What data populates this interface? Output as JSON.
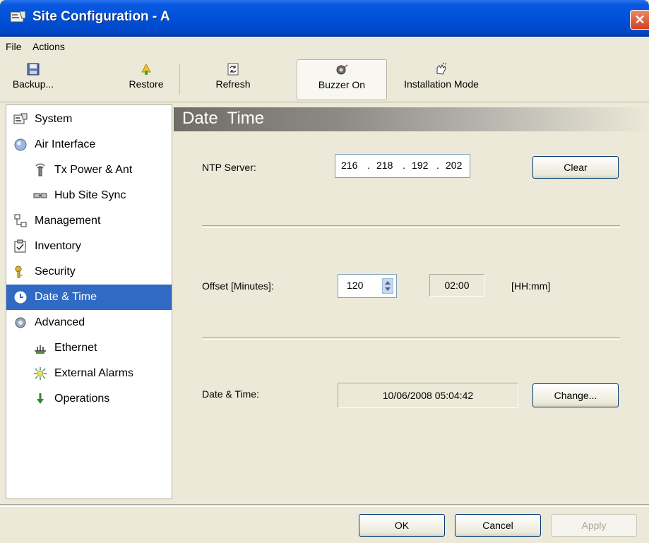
{
  "window": {
    "title": "Site Configuration - A"
  },
  "menu": {
    "file": "File",
    "actions": "Actions"
  },
  "toolbar": {
    "backup": "Backup...",
    "restore": "Restore",
    "refresh": "Refresh",
    "buzzer": "Buzzer On",
    "installation": "Installation Mode"
  },
  "sidebar": {
    "items": [
      {
        "label": "System",
        "icon": "system-icon"
      },
      {
        "label": "Air Interface",
        "icon": "air-interface-icon"
      },
      {
        "label": "Tx Power & Ant",
        "icon": "antenna-icon"
      },
      {
        "label": "Hub Site Sync",
        "icon": "sync-icon"
      },
      {
        "label": "Management",
        "icon": "management-icon"
      },
      {
        "label": "Inventory",
        "icon": "inventory-icon"
      },
      {
        "label": "Security",
        "icon": "security-icon"
      },
      {
        "label": "Date & Time",
        "icon": "clock-icon",
        "selected": true
      },
      {
        "label": "Advanced",
        "icon": "advanced-icon"
      },
      {
        "label": "Ethernet",
        "icon": "ethernet-icon"
      },
      {
        "label": "External Alarms",
        "icon": "alarm-icon"
      },
      {
        "label": "Operations",
        "icon": "operations-icon"
      }
    ]
  },
  "content": {
    "title": "Date  Time",
    "ntp": {
      "label": "NTP Server:",
      "o1": "216",
      "o2": "218",
      "o3": "192",
      "o4": "202",
      "dot": ".",
      "clear": "Clear"
    },
    "offset": {
      "label": "Offset [Minutes]:",
      "value": "120",
      "time": "02:00",
      "format": "[HH:mm]"
    },
    "datetime": {
      "label": "Date & Time:",
      "value": "10/06/2008 05:04:42",
      "change": "Change..."
    }
  },
  "footer": {
    "ok": "OK",
    "cancel": "Cancel",
    "apply": "Apply"
  },
  "colors": {
    "titlebar": "#0051d8",
    "selection": "#316ac5",
    "window_bg": "#ece9d8"
  }
}
